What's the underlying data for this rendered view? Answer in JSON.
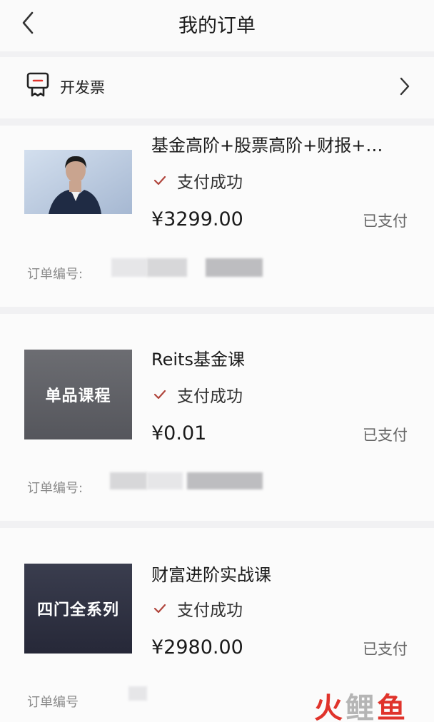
{
  "header": {
    "title": "我的订单",
    "back_icon": "chevron-left-icon"
  },
  "invoice": {
    "label": "开发票",
    "icon": "receipt-icon",
    "arrow_icon": "chevron-right-icon"
  },
  "orders": [
    {
      "title": "基金高阶+股票高阶+财报+…",
      "status": "支付成功",
      "price": "¥3299.00",
      "payment_state": "已支付",
      "order_no_label": "订单编号:",
      "thumb_text": ""
    },
    {
      "title": "Reits基金课",
      "status": "支付成功",
      "price": "¥0.01",
      "payment_state": "已支付",
      "order_no_label": "订单编号:",
      "thumb_text": "单品课程"
    },
    {
      "title": "财富进阶实战课",
      "status": "支付成功",
      "price": "¥2980.00",
      "payment_state": "已支付",
      "order_no_label": "订单编号",
      "thumb_text": "四门全系列"
    }
  ],
  "watermark": {
    "part1": "火",
    "part2": "鲤",
    "part3": "鱼"
  },
  "colors": {
    "check": "#b0453c",
    "watermark_red": "#e0332b"
  }
}
